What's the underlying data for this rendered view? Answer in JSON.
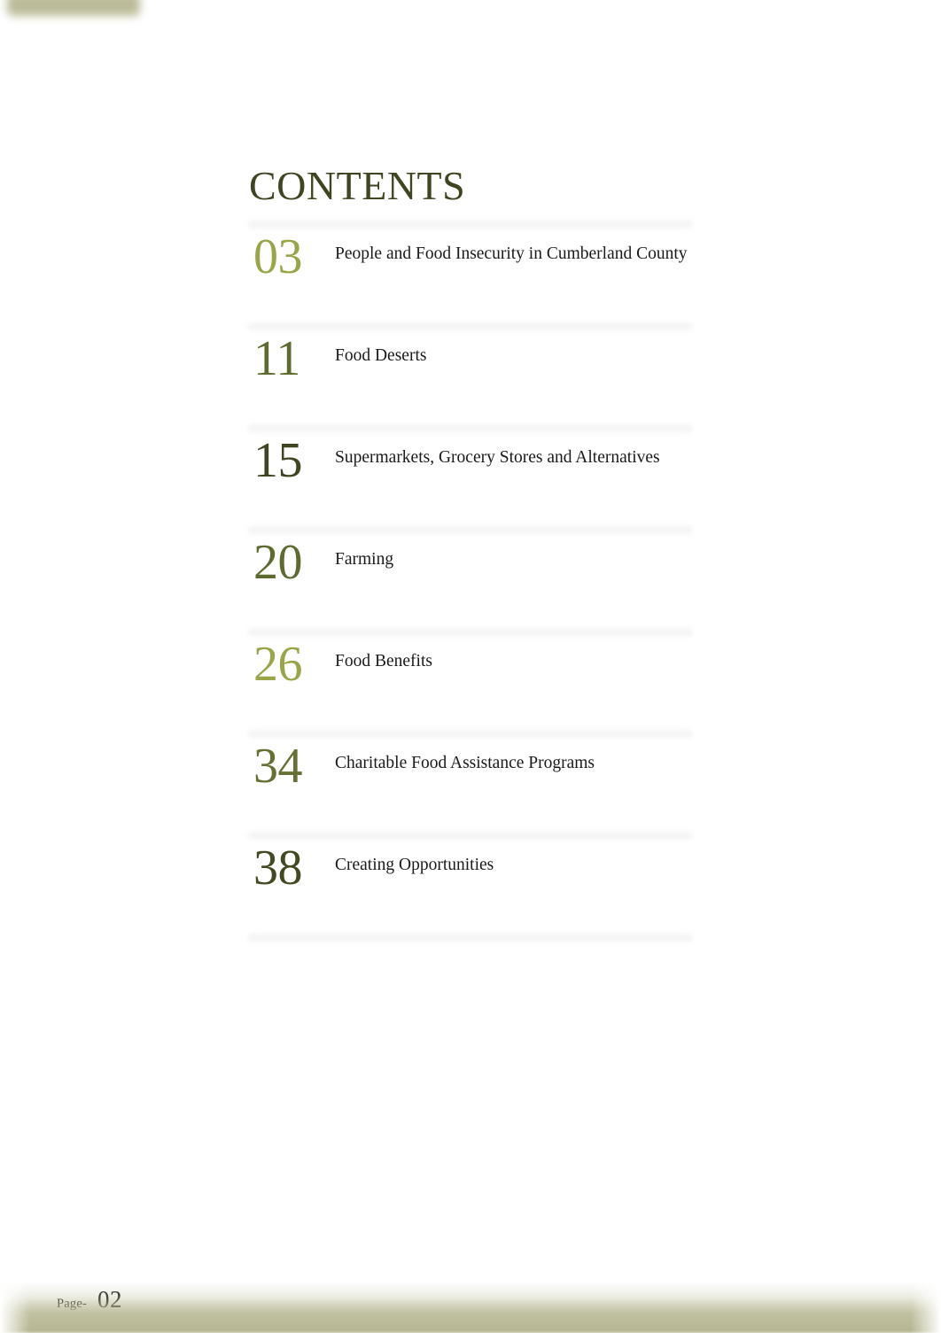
{
  "document": {
    "title": "CONTENTS",
    "title_color": "#3d4521",
    "body_text_color": "#1a1a1a",
    "page_background": "#ffffff"
  },
  "toc": {
    "entries": [
      {
        "number": "03",
        "title": "People and Food Insecurity in Cumberland County",
        "number_color": "#9aa548"
      },
      {
        "number": "11",
        "title": "Food Deserts",
        "number_color": "#5e6b2e"
      },
      {
        "number": "15",
        "title": "Supermarkets, Grocery Stores and Alternatives",
        "number_color": "#3e4520"
      },
      {
        "number": "20",
        "title": "Farming",
        "number_color": "#5e6b2e"
      },
      {
        "number": "26",
        "title": "Food Benefits",
        "number_color": "#9aa548"
      },
      {
        "number": "34",
        "title": "Charitable Food Assistance Programs",
        "number_color": "#667033"
      },
      {
        "number": "38",
        "title": "Creating Opportunities",
        "number_color": "#414a20"
      }
    ]
  },
  "footer": {
    "label": "Page-",
    "number": "02",
    "band_color": "#b4b48f"
  },
  "decoration": {
    "top_bar_color": "#b8b894"
  }
}
